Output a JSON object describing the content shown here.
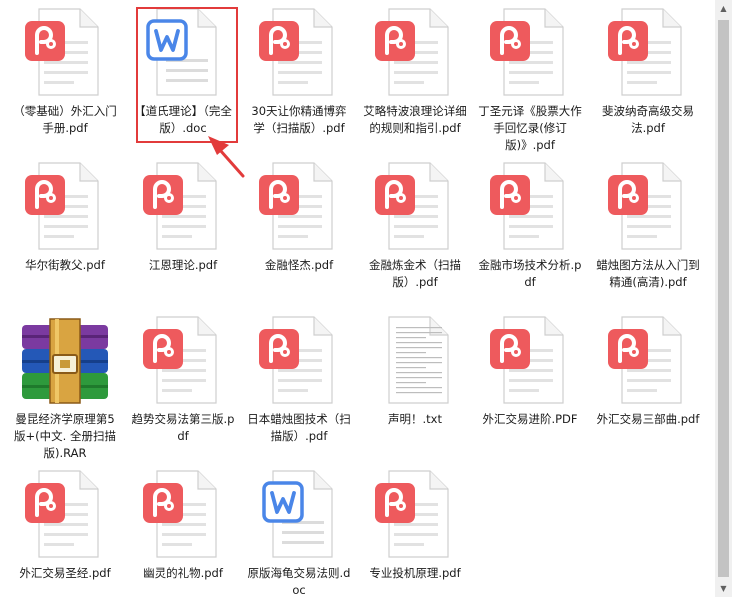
{
  "files": [
    {
      "name": "（零基础）外汇入门手册.pdf",
      "type": "pdf"
    },
    {
      "name": "【道氏理论】（完全版）.doc",
      "type": "doc",
      "selected": true
    },
    {
      "name": "30天让你精通博弈学（扫描版）.pdf",
      "type": "pdf"
    },
    {
      "name": "艾略特波浪理论详细的规则和指引.pdf",
      "type": "pdf"
    },
    {
      "name": "丁圣元译《股票大作手回忆录(修订版)》.pdf",
      "type": "pdf"
    },
    {
      "name": "斐波纳奇高级交易法.pdf",
      "type": "pdf"
    },
    {
      "name": "华尔街教父.pdf",
      "type": "pdf"
    },
    {
      "name": "江恩理论.pdf",
      "type": "pdf"
    },
    {
      "name": "金融怪杰.pdf",
      "type": "pdf"
    },
    {
      "name": "金融炼金术（扫描版）.pdf",
      "type": "pdf"
    },
    {
      "name": "金融市场技术分析.pdf",
      "type": "pdf"
    },
    {
      "name": "蜡烛图方法从入门到精通(高清).pdf",
      "type": "pdf"
    },
    {
      "name": "曼昆经济学原理第5版+(中文. 全册扫描版).RAR",
      "type": "rar"
    },
    {
      "name": "趋势交易法第三版.pdf",
      "type": "pdf"
    },
    {
      "name": "日本蜡烛图技术（扫描版）.pdf",
      "type": "pdf"
    },
    {
      "name": "声明！.txt",
      "type": "txt"
    },
    {
      "name": "外汇交易进阶.PDF",
      "type": "pdf"
    },
    {
      "name": "外汇交易三部曲.pdf",
      "type": "pdf"
    },
    {
      "name": "外汇交易圣经.pdf",
      "type": "pdf"
    },
    {
      "name": "幽灵的礼物.pdf",
      "type": "pdf"
    },
    {
      "name": "原版海龟交易法则.doc",
      "type": "doc"
    },
    {
      "name": "专业投机原理.pdf",
      "type": "pdf"
    }
  ],
  "icons": {
    "pdf": "pdf-icon",
    "doc": "word-doc-icon",
    "rar": "winrar-archive-icon",
    "txt": "text-file-icon"
  },
  "colors": {
    "pdf_badge": "#ee5a5d",
    "doc_badge": "#4a86e8",
    "selection": "#e23b3b",
    "scrollbar_thumb": "#c3c3c3"
  }
}
